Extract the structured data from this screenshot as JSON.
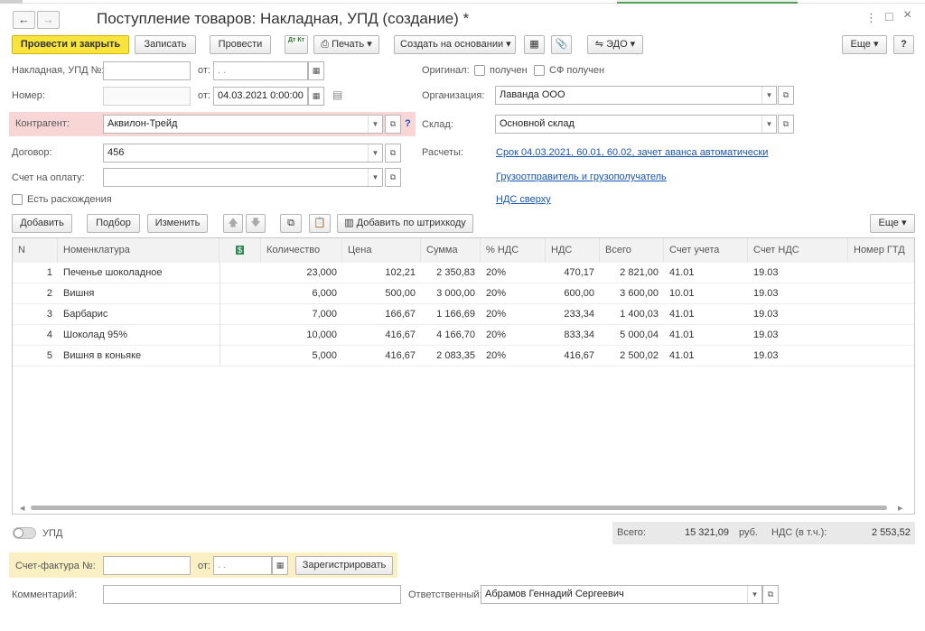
{
  "window": {
    "title": "Поступление товаров: Накладная, УПД (создание) *",
    "nav_back": "←",
    "nav_forward": "→",
    "menu_dots": "⋮",
    "maximize": "□",
    "close": "×"
  },
  "toolbar": {
    "post_close": "Провести и закрыть",
    "save": "Записать",
    "post": "Провести",
    "dt_kt": "Дт Кт",
    "print": "Печать",
    "create_based": "Создать на основании",
    "edo": "ЭДО",
    "more": "Еще",
    "help": "?"
  },
  "form": {
    "invoice_label": "Накладная, УПД №:",
    "invoice_value": "",
    "from_label": "от:",
    "invoice_date": " .  .",
    "number_label": "Номер:",
    "number_value": "",
    "number_date": "04.03.2021  0:00:00",
    "counterparty_label": "Контрагент:",
    "counterparty_value": "Аквилон-Трейд",
    "counterparty_help": "?",
    "contract_label": "Договор:",
    "contract_value": "456",
    "payment_label": "Счет на оплату:",
    "payment_value": "",
    "discrepancy_label": "Есть расхождения",
    "original_label": "Оригинал:",
    "received_label": "получен",
    "sf_received_label": "СФ получен",
    "org_label": "Организация:",
    "org_value": "Лаванда ООО",
    "warehouse_label": "Склад:",
    "warehouse_value": "Основной склад",
    "settlements_label": "Расчеты:",
    "settlements_link": "Срок 04.03.2021, 60.01, 60.02, зачет аванса автоматически",
    "shipper_link": "Грузоотправитель и грузополучатель",
    "vat_link": "НДС сверху"
  },
  "table_toolbar": {
    "add": "Добавить",
    "pick": "Подбор",
    "change": "Изменить",
    "add_barcode": "Добавить по штрихкоду",
    "more": "Еще"
  },
  "table": {
    "headers": [
      "N",
      "Номенклатура",
      "",
      "Количество",
      "Цена",
      "Сумма",
      "% НДС",
      "НДС",
      "Всего",
      "Счет учета",
      "Счет НДС",
      "Номер ГТД"
    ],
    "rows": [
      {
        "n": "1",
        "name": "Печенье шоколадное",
        "qty": "23,000",
        "price": "102,21",
        "sum": "2 350,83",
        "vat_rate": "20%",
        "vat": "470,17",
        "total": "2 821,00",
        "account": "41.01",
        "vat_account": "19.03",
        "gtd": ""
      },
      {
        "n": "2",
        "name": "Вишня",
        "qty": "6,000",
        "price": "500,00",
        "sum": "3 000,00",
        "vat_rate": "20%",
        "vat": "600,00",
        "total": "3 600,00",
        "account": "10.01",
        "vat_account": "19.03",
        "gtd": ""
      },
      {
        "n": "3",
        "name": "Барбарис",
        "qty": "7,000",
        "price": "166,67",
        "sum": "1 166,69",
        "vat_rate": "20%",
        "vat": "233,34",
        "total": "1 400,03",
        "account": "41.01",
        "vat_account": "19.03",
        "gtd": ""
      },
      {
        "n": "4",
        "name": "Шоколад 95%",
        "qty": "10,000",
        "price": "416,67",
        "sum": "4 166,70",
        "vat_rate": "20%",
        "vat": "833,34",
        "total": "5 000,04",
        "account": "41.01",
        "vat_account": "19.03",
        "gtd": ""
      },
      {
        "n": "5",
        "name": "Вишня в коньяке",
        "qty": "5,000",
        "price": "416,67",
        "sum": "2 083,35",
        "vat_rate": "20%",
        "vat": "416,67",
        "total": "2 500,02",
        "account": "41.01",
        "vat_account": "19.03",
        "gtd": ""
      }
    ]
  },
  "footer": {
    "upd_label": "УПД",
    "total_label": "Всего:",
    "total_value": "15 321,09",
    "currency": "руб.",
    "vat_incl_label": "НДС (в т.ч.):",
    "vat_incl_value": "2 553,52",
    "invoice_no_label": "Счет-фактура №:",
    "invoice_no_value": "",
    "invoice_from_label": "от:",
    "invoice_from_date": " .  .",
    "register_button": "Зарегистрировать",
    "comment_label": "Комментарий:",
    "comment_value": "",
    "responsible_label": "Ответственный:",
    "responsible_value": "Абрамов Геннадий Сергеевич"
  },
  "colors": {
    "primary_button": "#f8e43d",
    "link": "#1a56b5",
    "counterparty_highlight": "#f8d6d6",
    "invoice_highlight": "#fbf0c4",
    "totals_bg": "#e9e9e9"
  }
}
